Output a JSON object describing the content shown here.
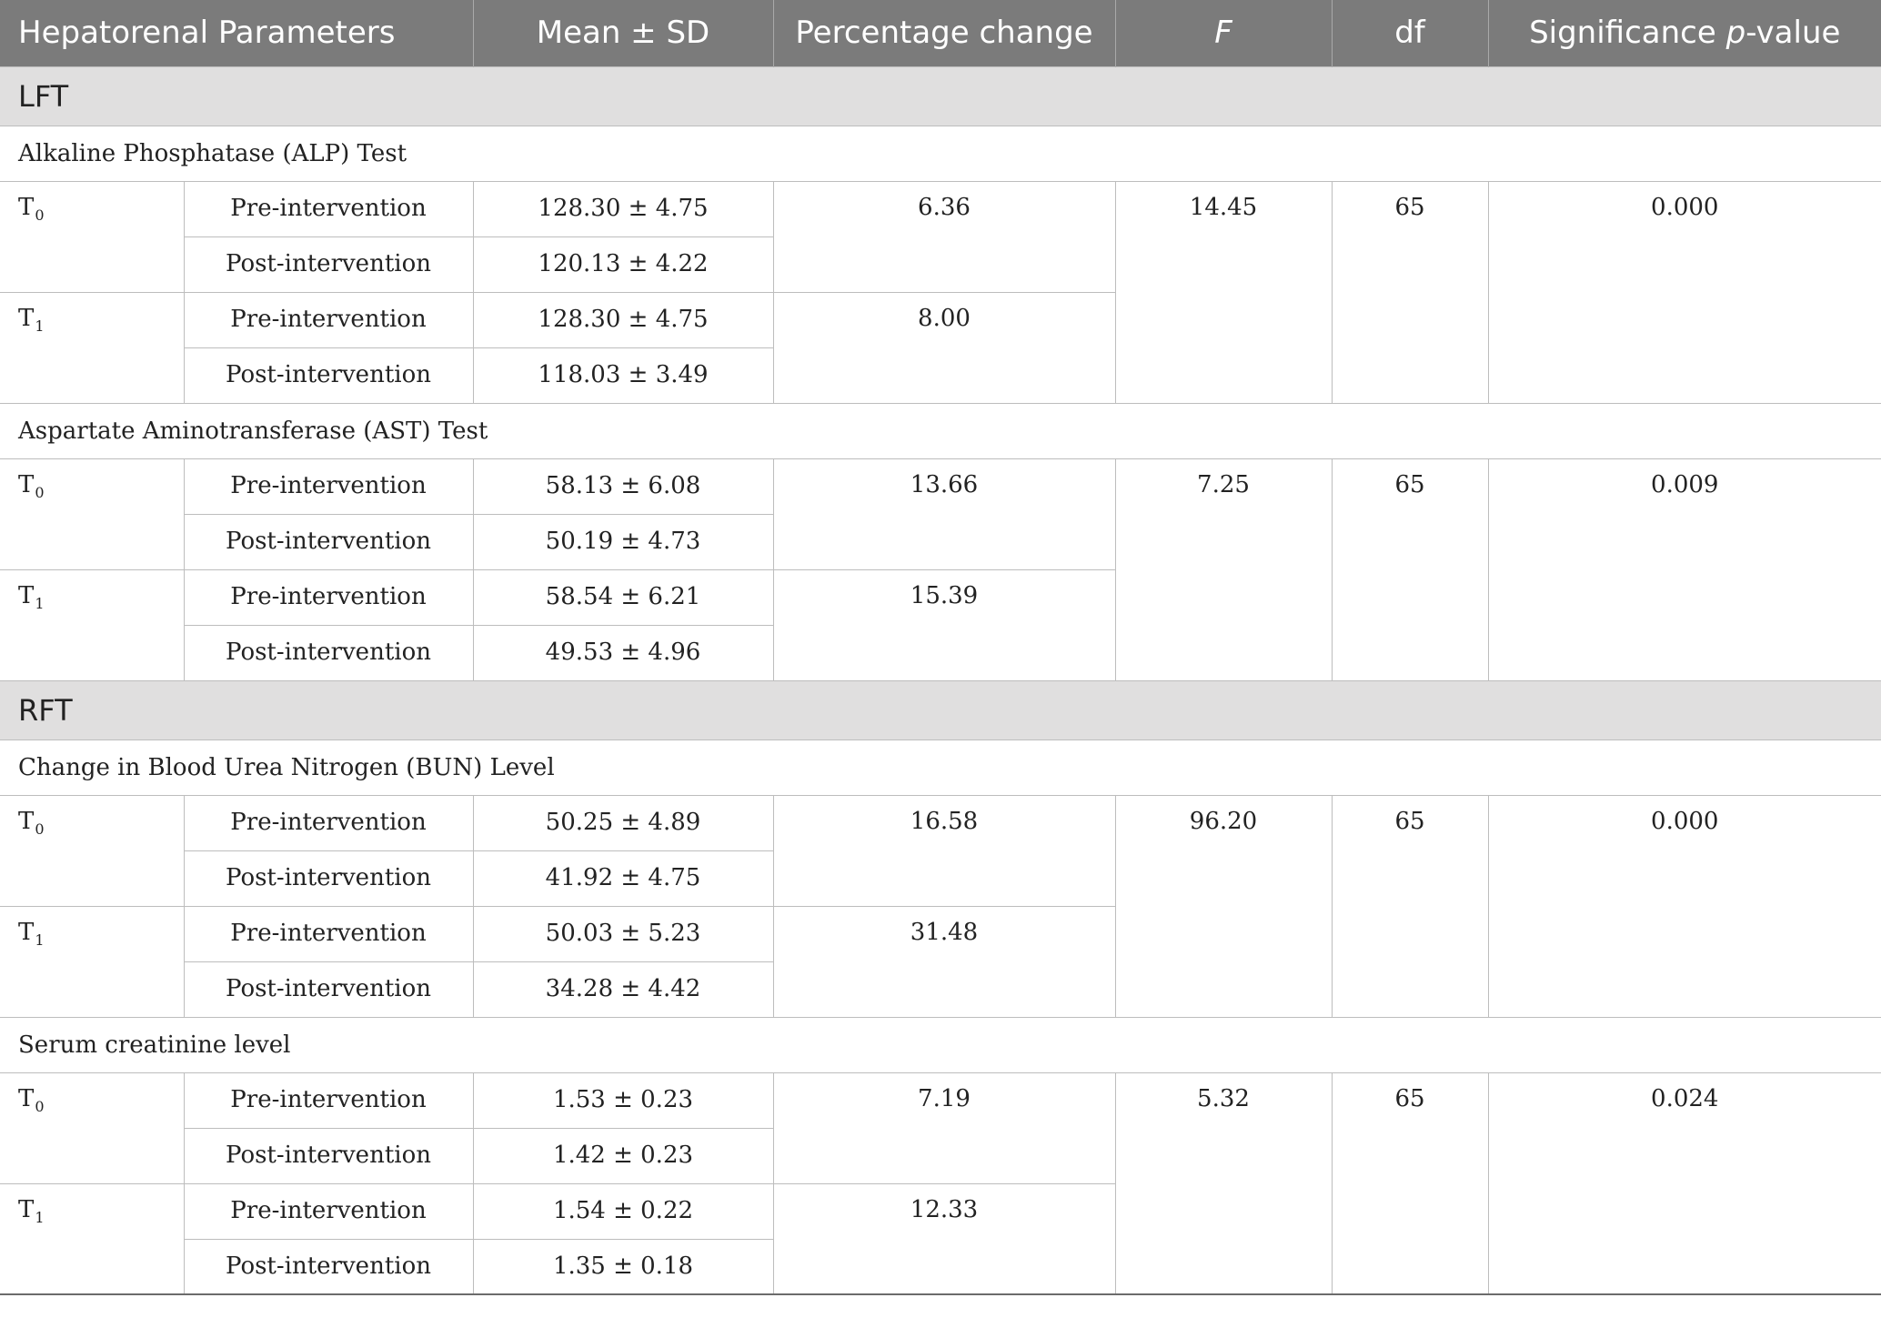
{
  "header": {
    "col_parameters": "Hepatorenal Parameters",
    "col_mean_sd": "Mean ± SD",
    "col_pct_change": "Percentage change",
    "col_f": "F",
    "col_df": "df",
    "col_sig_prefix": "Significance ",
    "col_sig_p": "p",
    "col_sig_suffix": "-value"
  },
  "sections": [
    {
      "label": "LFT",
      "parameters": [
        {
          "name": "Alkaline Phosphatase (ALP) Test",
          "F": "14.45",
          "df": "65",
          "p": "0.000",
          "times": [
            {
              "base": "T",
              "sub": "0",
              "pct": "6.36",
              "pre_label": "Pre-intervention",
              "pre": "128.30 ± 4.75",
              "post_label": "Post-intervention",
              "post": "120.13 ± 4.22"
            },
            {
              "base": "T",
              "sub": "1",
              "pct": "8.00",
              "pre_label": "Pre-intervention",
              "pre": "128.30 ± 4.75",
              "post_label": "Post-intervention",
              "post": "118.03 ± 3.49"
            }
          ]
        },
        {
          "name": "Aspartate Aminotransferase (AST) Test",
          "F": "7.25",
          "df": "65",
          "p": "0.009",
          "times": [
            {
              "base": "T",
              "sub": "0",
              "pct": "13.66",
              "pre_label": "Pre-intervention",
              "pre": "58.13 ± 6.08",
              "post_label": "Post-intervention",
              "post": "50.19 ± 4.73"
            },
            {
              "base": "T",
              "sub": "1",
              "pct": "15.39",
              "pre_label": "Pre-intervention",
              "pre": "58.54 ± 6.21",
              "post_label": "Post-intervention",
              "post": "49.53 ± 4.96"
            }
          ]
        }
      ]
    },
    {
      "label": "RFT",
      "parameters": [
        {
          "name": "Change in Blood Urea Nitrogen (BUN) Level",
          "F": "96.20",
          "df": "65",
          "p": "0.000",
          "times": [
            {
              "base": "T",
              "sub": "0",
              "pct": "16.58",
              "pre_label": "Pre-intervention",
              "pre": "50.25 ± 4.89",
              "post_label": "Post-intervention",
              "post": "41.92 ± 4.75"
            },
            {
              "base": "T",
              "sub": "1",
              "pct": "31.48",
              "pre_label": "Pre-intervention",
              "pre": "50.03 ± 5.23",
              "post_label": "Post-intervention",
              "post": "34.28 ± 4.42"
            }
          ]
        },
        {
          "name": "Serum creatinine level",
          "F": "5.32",
          "df": "65",
          "p": "0.024",
          "times": [
            {
              "base": "T",
              "sub": "0",
              "pct": "7.19",
              "pre_label": "Pre-intervention",
              "pre": "1.53 ± 0.23",
              "post_label": "Post-intervention",
              "post": "1.42 ± 0.23"
            },
            {
              "base": "T",
              "sub": "1",
              "pct": "12.33",
              "pre_label": "Pre-intervention",
              "pre": "1.54 ± 0.22",
              "post_label": "Post-intervention",
              "post": "1.35 ± 0.18"
            }
          ]
        }
      ]
    }
  ]
}
